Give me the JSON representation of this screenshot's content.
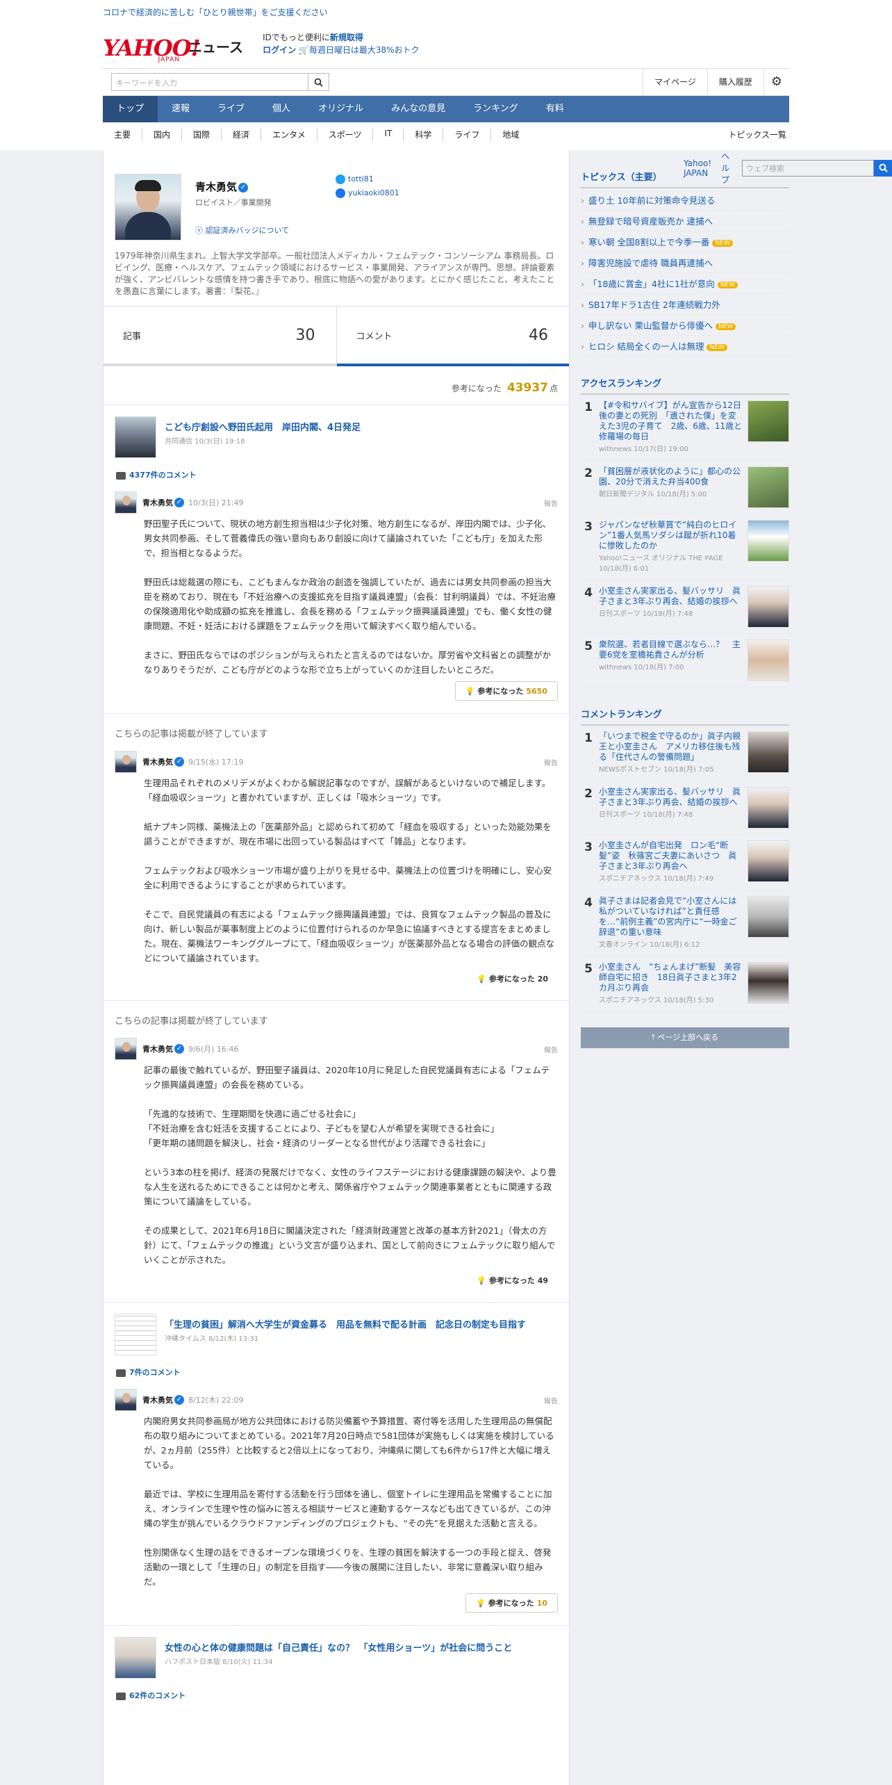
{
  "topbar": {
    "promo": "コロナで経済的に苦しむ「ひとり親世帯」をご支援ください",
    "yj": "Yahoo! JAPAN",
    "help": "ヘルプ",
    "web_placeholder": "ウェブ検索"
  },
  "logo": {
    "yahoo": "YAHOO!",
    "japan": "JAPAN",
    "news": "ニュース"
  },
  "header": {
    "line1_pre": "IDでもっと便利に",
    "line1_link": "新規取得",
    "login": "ログイン",
    "cart": "毎週日曜日は最大38%おトク"
  },
  "search": {
    "placeholder": "キーワードを入力",
    "mypage": "マイページ",
    "history": "購入履歴"
  },
  "nav": [
    "トップ",
    "速報",
    "ライブ",
    "個人",
    "オリジナル",
    "みんなの意見",
    "ランキング",
    "有料"
  ],
  "subnav": [
    "主要",
    "国内",
    "国際",
    "経済",
    "エンタメ",
    "スポーツ",
    "IT",
    "科学",
    "ライフ",
    "地域"
  ],
  "subnav_right": "トピックス一覧",
  "profile": {
    "name": "青木勇気",
    "role": "ロビイスト／事業開発",
    "badge_link": "認証済みバッジについて",
    "twitter": "totti81",
    "facebook": "yukiaoki0801",
    "bio": "1979年神奈川県生まれ。上智大学文学部卒。一般社団法人メディカル・フェムテック・コンソーシアム 事務局長。ロビイング、医療・ヘルスケア、フェムテック領域におけるサービス・事業開発、アライアンスが専門。思想、評論要素が強く、アンビバレントな感情を持つ書き手であり、根底に物語への愛があります。とにかく感じたこと、考えたことを愚直に言葉にします。著書：『梨花、』"
  },
  "stats": {
    "articles_label": "記事",
    "articles": "30",
    "comments_label": "コメント",
    "comments": "46"
  },
  "points": {
    "label": "参考になった",
    "value": "43937",
    "unit": "点"
  },
  "articles": [
    {
      "title": "こども庁創設へ野田氏起用　岸田内閣、4日発足",
      "source": "共同通信 10/3(日) 19:18",
      "comments": "4377件のコメント",
      "comment": {
        "name": "青木勇気",
        "date": "10/3(日) 21:49",
        "report": "報告",
        "paras": [
          "野田聖子氏について、現状の地方創生担当相は少子化対策、地方創生になるが、岸田内閣では、少子化、男女共同参画、そして菅義偉氏の強い意向もあり創設に向けて議論されていた「こども庁」を加えた形で、担当相となるようだ。",
          "野田氏は総裁選の際にも、こどもまんなか政治の創造を強調していたが、過去には男女共同参画の担当大臣を務めており、現在も「不妊治療への支援拡充を目指す議員連盟」（会長：甘利明議員）では、不妊治療の保険適用化や助成額の拡充を推進し、会長を務める「フェムテック振興議員連盟」でも、働く女性の健康問題、不妊・妊活における課題をフェムテックを用いて解決すべく取り組んでいる。",
          "まさに、野田氏ならではのポジションが与えられたと言えるのではないか。厚労省や文科省との調整がかなりありそうだが、こども庁がどのような形で立ち上がっていくのか注目したいところだ。"
        ],
        "helpful": "参考になった",
        "count": "5650"
      }
    },
    {
      "ended": "こちらの記事は掲載が終了しています",
      "comment": {
        "name": "青木勇気",
        "date": "9/15(水) 17:19",
        "report": "報告",
        "paras": [
          "生理用品それぞれのメリデメがよくわかる解説記事なのですが、誤解があるといけないので補足します。「経血吸収ショーツ」と書かれていますが、正しくは「吸水ショーツ」です。",
          "紙ナプキン同様、薬機法上の「医薬部外品」と認められて初めて「経血を吸収する」といった効能効果を謳うことができますが、現在市場に出回っている製品はすべて「雑品」となります。",
          "フェムテックおよび吸水ショーツ市場が盛り上がりを見せる中、薬機法上の位置づけを明確にし、安心安全に利用できるようにすることが求められています。",
          "そこで、自民党議員の有志による「フェムテック振興議員連盟」では、良質なフェムテック製品の普及に向け、新しい製品が薬事制度上どのように位置付けられるのか早急に協議すべきとする提言をまとめました。現在、薬機法ワーキンググループにて、「経血吸収ショーツ」が医薬部外品となる場合の評価の観点などについて議論されています。"
        ],
        "helpful": "参考になった",
        "count": "20"
      }
    },
    {
      "ended": "こちらの記事は掲載が終了しています",
      "comment": {
        "name": "青木勇気",
        "date": "9/6(月) 16:46",
        "report": "報告",
        "paras": [
          "記事の最後で触れているが、野田聖子議員は、2020年10月に発足した自民党議員有志による「フェムテック振興議員連盟」の会長を務めている。",
          "「先進的な技術で、生理期間を快適に過ごせる社会に」\n「不妊治療を含む妊活を支援することにより、子どもを望む人が希望を実現できる社会に」\n「更年期の諸問題を解決し、社会・経済のリーダーとなる世代がより活躍できる社会に」",
          "という3本の柱を掲げ、経済の発展だけでなく、女性のライフステージにおける健康課題の解決や、より豊な人生を送れるためにできることは何かと考え、関係省庁やフェムテック関連事業者とともに関連する政策について議論をしている。",
          "その成果として、2021年6月18日に閣議決定された「経済財政運営と改革の基本方針2021」（骨太の方針）にて、「フェムテックの推進」という文言が盛り込まれ、国として前向きにフェムテックに取り組んでいくことが示された。"
        ],
        "helpful": "参考になった",
        "count": "49"
      }
    },
    {
      "title": "「生理の貧困」解消へ大学生が資金募る　用品を無料で配る計画　記念日の制定も目指す",
      "source": "沖縄タイムス 8/12(木) 13:31",
      "comments": "7件のコメント",
      "comment": {
        "name": "青木勇気",
        "date": "8/12(木) 22:09",
        "report": "報告",
        "paras": [
          "内閣府男女共同参画局が地方公共団体における防災備蓄や予算措置、寄付等を活用した生理用品の無償配布の取り組みについてまとめている。2021年7月20日時点で581団体が実施もしくは実施を検討しているが、2ヵ月前（255件）と比較すると2倍以上になっており、沖縄県に関しても6件から17件と大幅に増えている。",
          "最近では、学校に生理用品を寄付する活動を行う団体を通し、個室トイレに生理用品を常備することに加え、オンラインで生理や性の悩みに答える相談サービスと連動するケースなども出てきているが、この沖縄の学生が挑んでいるクラウドファンディングのプロジェクトも、“その先”を見据えた活動と言える。",
          "性別関係なく生理の話をできるオープンな環境づくりを、生理の貧困を解決する一つの手段と捉え、啓発活動の一環として「生理の日」の制定を目指す――今後の展開に注目したい、非常に意義深い取り組みだ。"
        ],
        "helpful": "参考になった",
        "count": "10"
      }
    },
    {
      "title": "女性の心と体の健康問題は「自己責任」なの？　「女性用ショーツ」が社会に問うこと",
      "source": "ハフポスト日本版 8/10(火) 11:34",
      "comments": "62件のコメント"
    }
  ],
  "topics": {
    "heading": "トピックス（主要）",
    "new_label": "NEW",
    "items": [
      {
        "t": "盛り土 10年前に対策命令見送る",
        "new": false
      },
      {
        "t": "無登録で暗号資産販売か 逮捕へ",
        "new": false
      },
      {
        "t": "寒い朝 全国8割以上で今季一番",
        "new": true
      },
      {
        "t": "障害児施設で虐待 職員再逮捕へ",
        "new": false
      },
      {
        "t": "「18歳に賞金」4社に1社が意向",
        "new": true
      },
      {
        "t": "SB17年ドラ1古住 2年連続戦力外",
        "new": false
      },
      {
        "t": "申し訳ない 栗山監督から俳優へ",
        "new": true
      },
      {
        "t": "ヒロシ 結局全くの一人は無理",
        "new": true
      }
    ]
  },
  "access_ranking": {
    "heading": "アクセスランキング",
    "items": [
      {
        "n": "1",
        "t": "【#令和サバイブ】がん宣告から12日後の妻との死別　「遺された僕」を変えた3児の子育て　2歳、6歳、11歳と修羅場の毎日",
        "m": "withnews 10/17(日) 19:00"
      },
      {
        "n": "2",
        "t": "「貧困層が液状化のように」都心の公園、20分で消えた弁当400食",
        "m": "朝日新聞デジタル 10/18(月) 5:00"
      },
      {
        "n": "3",
        "t": "ジャパンなぜ秋華賞で“純白のヒロイン”1番人気馬ソダシは蹴が折れ10着に惨敗したのか",
        "m": "Yahoo!ニュース オリジナル THE PAGE 10/18(月) 6:01"
      },
      {
        "n": "4",
        "t": "小室圭さん実家出る、髪バッサリ　眞子さまと3年ぶり再会、結婚の挨拶へ",
        "m": "日刊スポーツ 10/18(月) 7:48"
      },
      {
        "n": "5",
        "t": "衆院選、若者目線で選ぶなら…？　主要6党を室橋祐貴さんが分析",
        "m": "withnews 10/18(月) 7:00"
      }
    ]
  },
  "comment_ranking": {
    "heading": "コメントランキング",
    "items": [
      {
        "n": "1",
        "t": "「いつまで税金で守るのか」眞子内親王と小室圭さん　アメリカ移住後も残る「住代さんの警備問題」",
        "m": "NEWSポストセブン 10/18(月) 7:05"
      },
      {
        "n": "2",
        "t": "小室圭さん実家出る、髪バッサリ　眞子さまと3年ぶり再会、結婚の挨拶へ",
        "m": "日刊スポーツ 10/18(月) 7:48"
      },
      {
        "n": "3",
        "t": "小室圭さんが自宅出発　ロン毛“断髪”姿　秋篠宮ご夫妻にあいさつ　眞子さまと3年ぶり再会へ",
        "m": "スポニチアネックス 10/18(月) 7:49"
      },
      {
        "n": "4",
        "t": "眞子さまは記者会見で“小室さんには私がついていなければ”と責任感を…“前例主義”の宮内庁に“一時金ご辞退”の重い意味",
        "m": "文春オンライン 10/18(月) 6:12"
      },
      {
        "n": "5",
        "t": "小室圭さん　“ちょんまげ”断髪　美容師自宅に招き　18日眞子さまと3年2カ月ぶり再会",
        "m": "スポニチアネックス 10/18(月) 5:30"
      }
    ]
  },
  "totop": "ページ上部へ戻る"
}
